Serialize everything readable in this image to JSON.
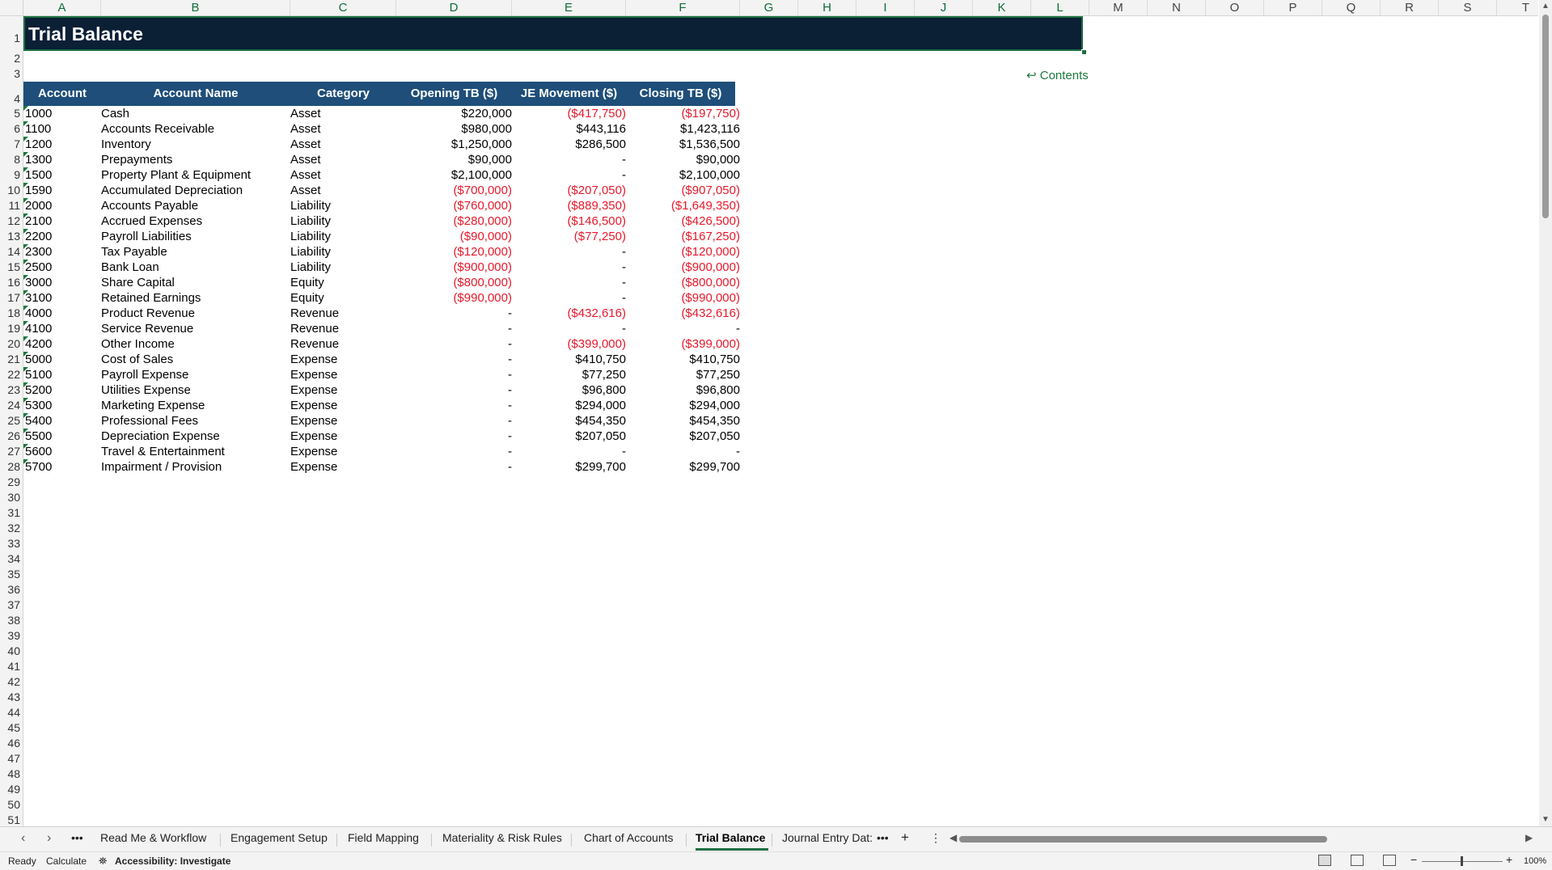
{
  "sheet": {
    "title": "Trial Balance",
    "contents_link": "↩ Contents",
    "selected_columns": [
      "A",
      "B",
      "C",
      "D",
      "E",
      "F",
      "G",
      "H",
      "I",
      "J",
      "K",
      "L"
    ],
    "columns": [
      "A",
      "B",
      "C",
      "D",
      "E",
      "F",
      "G",
      "H",
      "I",
      "J",
      "K",
      "L",
      "M",
      "N",
      "O",
      "P",
      "Q",
      "R",
      "S",
      "T"
    ],
    "rows": [
      "1",
      "2",
      "3",
      "4",
      "5",
      "6",
      "7",
      "8",
      "9",
      "10",
      "11",
      "12",
      "13",
      "14",
      "15",
      "16",
      "17",
      "18",
      "19",
      "20",
      "21",
      "22",
      "23",
      "24",
      "25",
      "26",
      "27",
      "28",
      "29",
      "30",
      "31",
      "32",
      "33",
      "34",
      "35",
      "36",
      "37",
      "38",
      "39",
      "40",
      "41",
      "42",
      "43",
      "44",
      "45",
      "46",
      "47",
      "48",
      "49",
      "50",
      "51"
    ]
  },
  "table": {
    "headers": [
      "Account",
      "Account Name",
      "Category",
      "Opening TB ($)",
      "JE Movement ($)",
      "Closing TB ($)"
    ],
    "rows": [
      {
        "acct": "1000",
        "name": "Cash",
        "cat": "Asset",
        "open": "$220,000",
        "je": "($417,750)",
        "close": "($197,750)"
      },
      {
        "acct": "1100",
        "name": "Accounts Receivable",
        "cat": "Asset",
        "open": "$980,000",
        "je": "$443,116",
        "close": "$1,423,116"
      },
      {
        "acct": "1200",
        "name": "Inventory",
        "cat": "Asset",
        "open": "$1,250,000",
        "je": "$286,500",
        "close": "$1,536,500"
      },
      {
        "acct": "1300",
        "name": "Prepayments",
        "cat": "Asset",
        "open": "$90,000",
        "je": "-",
        "close": "$90,000"
      },
      {
        "acct": "1500",
        "name": "Property Plant & Equipment",
        "cat": "Asset",
        "open": "$2,100,000",
        "je": "-",
        "close": "$2,100,000"
      },
      {
        "acct": "1590",
        "name": "Accumulated Depreciation",
        "cat": "Asset",
        "open": "($700,000)",
        "je": "($207,050)",
        "close": "($907,050)"
      },
      {
        "acct": "2000",
        "name": "Accounts Payable",
        "cat": "Liability",
        "open": "($760,000)",
        "je": "($889,350)",
        "close": "($1,649,350)"
      },
      {
        "acct": "2100",
        "name": "Accrued Expenses",
        "cat": "Liability",
        "open": "($280,000)",
        "je": "($146,500)",
        "close": "($426,500)"
      },
      {
        "acct": "2200",
        "name": "Payroll Liabilities",
        "cat": "Liability",
        "open": "($90,000)",
        "je": "($77,250)",
        "close": "($167,250)"
      },
      {
        "acct": "2300",
        "name": "Tax Payable",
        "cat": "Liability",
        "open": "($120,000)",
        "je": "-",
        "close": "($120,000)"
      },
      {
        "acct": "2500",
        "name": "Bank Loan",
        "cat": "Liability",
        "open": "($900,000)",
        "je": "-",
        "close": "($900,000)"
      },
      {
        "acct": "3000",
        "name": "Share Capital",
        "cat": "Equity",
        "open": "($800,000)",
        "je": "-",
        "close": "($800,000)"
      },
      {
        "acct": "3100",
        "name": "Retained Earnings",
        "cat": "Equity",
        "open": "($990,000)",
        "je": "-",
        "close": "($990,000)"
      },
      {
        "acct": "4000",
        "name": "Product Revenue",
        "cat": "Revenue",
        "open": "-",
        "je": "($432,616)",
        "close": "($432,616)"
      },
      {
        "acct": "4100",
        "name": "Service Revenue",
        "cat": "Revenue",
        "open": "-",
        "je": "-",
        "close": "-"
      },
      {
        "acct": "4200",
        "name": "Other Income",
        "cat": "Revenue",
        "open": "-",
        "je": "($399,000)",
        "close": "($399,000)"
      },
      {
        "acct": "5000",
        "name": "Cost of Sales",
        "cat": "Expense",
        "open": "-",
        "je": "$410,750",
        "close": "$410,750"
      },
      {
        "acct": "5100",
        "name": "Payroll Expense",
        "cat": "Expense",
        "open": "-",
        "je": "$77,250",
        "close": "$77,250"
      },
      {
        "acct": "5200",
        "name": "Utilities Expense",
        "cat": "Expense",
        "open": "-",
        "je": "$96,800",
        "close": "$96,800"
      },
      {
        "acct": "5300",
        "name": "Marketing Expense",
        "cat": "Expense",
        "open": "-",
        "je": "$294,000",
        "close": "$294,000"
      },
      {
        "acct": "5400",
        "name": "Professional Fees",
        "cat": "Expense",
        "open": "-",
        "je": "$454,350",
        "close": "$454,350"
      },
      {
        "acct": "5500",
        "name": "Depreciation Expense",
        "cat": "Expense",
        "open": "-",
        "je": "$207,050",
        "close": "$207,050"
      },
      {
        "acct": "5600",
        "name": "Travel & Entertainment",
        "cat": "Expense",
        "open": "-",
        "je": "-",
        "close": "-"
      },
      {
        "acct": "5700",
        "name": "Impairment / Provision",
        "cat": "Expense",
        "open": "-",
        "je": "$299,700",
        "close": "$299,700"
      }
    ]
  },
  "tabs": {
    "items": [
      "Read Me & Workflow",
      "Engagement Setup",
      "Field Mapping",
      "Materiality & Risk Rules",
      "Chart of Accounts",
      "Trial Balance",
      "Journal Entry Dat:"
    ],
    "active": "Trial Balance",
    "more": "•••",
    "add": "+",
    "menu": "⋮"
  },
  "status": {
    "ready": "Ready",
    "calculate": "Calculate",
    "accessibility": "Accessibility: Investigate",
    "zoom": "100%"
  },
  "colors": {
    "title_bg": "#0b1f35",
    "header_bg": "#1e4e79",
    "negative": "#e6192b",
    "accent": "#1d6f42"
  }
}
